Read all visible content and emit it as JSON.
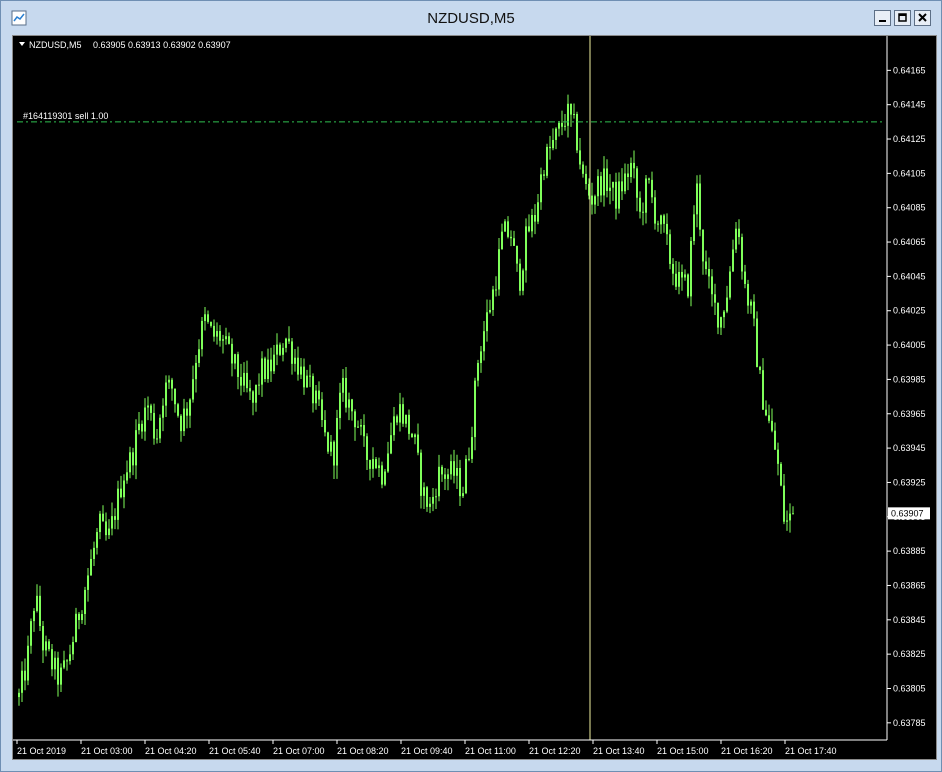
{
  "window": {
    "title": "NZDUSD,M5"
  },
  "chart_info": {
    "symbol_period": "NZDUSD,M5",
    "ohlc": "0.63905 0.63913 0.63902 0.63907"
  },
  "order_line": {
    "label": "#164119301 sell 1.00",
    "price": 0.64135
  },
  "current_price": {
    "label": "0.63907",
    "value": 0.63907
  },
  "colors": {
    "background": "#000000",
    "candles": "#7fff5a",
    "order_line": "#2fbf4f",
    "crosshair": "#f2f2a0",
    "axis_text": "#ffffff"
  },
  "chart_data": {
    "type": "candlestick",
    "symbol": "NZDUSD",
    "timeframe": "M5",
    "ylim": [
      0.63775,
      0.64185
    ],
    "y_ticks": [
      "0.64165",
      "0.64145",
      "0.64125",
      "0.64105",
      "0.64085",
      "0.64065",
      "0.64045",
      "0.64025",
      "0.64005",
      "0.63985",
      "0.63965",
      "0.63945",
      "0.63925",
      "0.63905",
      "0.63885",
      "0.63865",
      "0.63845",
      "0.63825",
      "0.63805",
      "0.63785"
    ],
    "x_ticks": [
      "21 Oct 2019",
      "21 Oct 03:00",
      "21 Oct 04:20",
      "21 Oct 05:40",
      "21 Oct 07:00",
      "21 Oct 08:20",
      "21 Oct 09:40",
      "21 Oct 11:00",
      "21 Oct 12:20",
      "21 Oct 13:40",
      "21 Oct 15:00",
      "21 Oct 16:20",
      "21 Oct 17:40"
    ],
    "close_path": [
      0.638,
      0.6382,
      0.6386,
      0.6383,
      0.6382,
      0.6381,
      0.6382,
      0.6384,
      0.6386,
      0.6388,
      0.639,
      0.6389,
      0.6391,
      0.6393,
      0.6394,
      0.6396,
      0.6397,
      0.6395,
      0.6398,
      0.6398,
      0.6396,
      0.6397,
      0.64,
      0.6402,
      0.6401,
      0.6401,
      0.64,
      0.6399,
      0.6398,
      0.6397,
      0.6399,
      0.6399,
      0.64,
      0.6401,
      0.64,
      0.6399,
      0.6398,
      0.6397,
      0.6395,
      0.6394,
      0.6398,
      0.6397,
      0.6396,
      0.6394,
      0.6394,
      0.6393,
      0.6395,
      0.6397,
      0.6396,
      0.6395,
      0.6392,
      0.6391,
      0.6393,
      0.6393,
      0.6393,
      0.6392,
      0.6395,
      0.64,
      0.6402,
      0.6404,
      0.6407,
      0.6407,
      0.6404,
      0.6407,
      0.6408,
      0.6411,
      0.6412,
      0.6413,
      0.6414,
      0.6413,
      0.641,
      0.6409,
      0.641,
      0.641,
      0.6409,
      0.641,
      0.6411,
      0.6408,
      0.641,
      0.6408,
      0.6407,
      0.6405,
      0.6404,
      0.6404,
      0.641,
      0.6405,
      0.6403,
      0.6402,
      0.6404,
      0.6408,
      0.6404,
      0.6402,
      0.6398,
      0.6396,
      0.6394,
      0.639,
      0.63907
    ]
  }
}
